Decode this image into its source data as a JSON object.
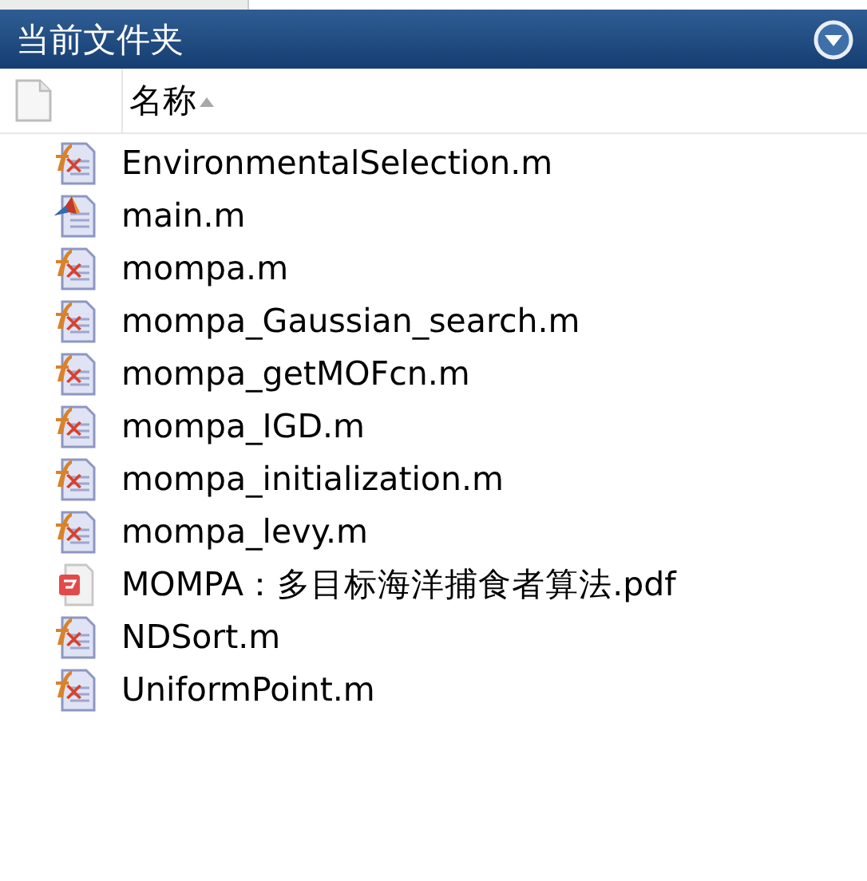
{
  "panel": {
    "title": "当前文件夹"
  },
  "columns": [
    {
      "label": "名称",
      "sort_ascending": true
    }
  ],
  "files": [
    {
      "name": "EnvironmentalSelection.m",
      "kind": "function"
    },
    {
      "name": "main.m",
      "kind": "script"
    },
    {
      "name": "mompa.m",
      "kind": "function"
    },
    {
      "name": "mompa_Gaussian_search.m",
      "kind": "function"
    },
    {
      "name": "mompa_getMOFcn.m",
      "kind": "function"
    },
    {
      "name": "mompa_IGD.m",
      "kind": "function"
    },
    {
      "name": "mompa_initialization.m",
      "kind": "function"
    },
    {
      "name": "mompa_levy.m",
      "kind": "function"
    },
    {
      "name": "MOMPA：多目标海洋捕食者算法.pdf",
      "kind": "pdf"
    },
    {
      "name": "NDSort.m",
      "kind": "function"
    },
    {
      "name": "UniformPoint.m",
      "kind": "function"
    }
  ]
}
